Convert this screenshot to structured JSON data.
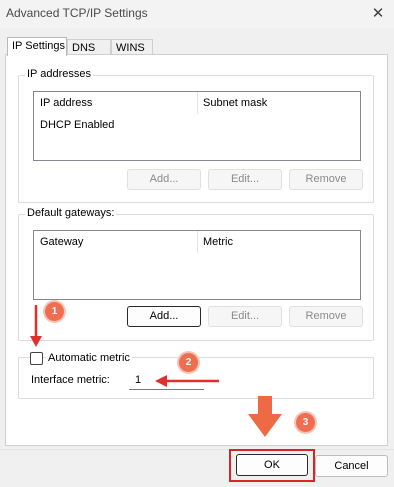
{
  "window": {
    "title": "Advanced TCP/IP Settings",
    "close_glyph": "✕"
  },
  "tabs": [
    {
      "label": "IP Settings",
      "active": true
    },
    {
      "label": "DNS",
      "active": false
    },
    {
      "label": "WINS",
      "active": false
    }
  ],
  "ip_addresses": {
    "legend": "IP addresses",
    "columns": [
      "IP address",
      "Subnet mask"
    ],
    "rows": [
      [
        "DHCP Enabled",
        ""
      ]
    ],
    "buttons": {
      "add": "Add...",
      "edit": "Edit...",
      "remove": "Remove"
    }
  },
  "default_gateways": {
    "legend": "Default gateways:",
    "columns": [
      "Gateway",
      "Metric"
    ],
    "rows": [],
    "buttons": {
      "add": "Add...",
      "edit": "Edit...",
      "remove": "Remove"
    }
  },
  "automatic_metric": {
    "label": "Automatic metric",
    "checked": false
  },
  "interface_metric": {
    "label": "Interface metric:",
    "value": "1"
  },
  "annotations": {
    "badge_1": "1",
    "badge_2": "2",
    "badge_3": "3",
    "arrow_color": "#e0302e",
    "badge_color": "#ef6e50",
    "highlight_color": "#d8252c"
  },
  "footer": {
    "ok": "OK",
    "cancel": "Cancel"
  }
}
